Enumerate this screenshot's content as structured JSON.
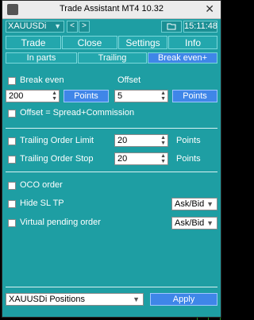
{
  "window": {
    "title": "Trade Assistant MT4 10.32"
  },
  "toolbar": {
    "symbol": "XAUUSDi",
    "prev": "<",
    "next": ">",
    "time": "15:11:48"
  },
  "tabs": [
    "Trade",
    "Close",
    "Settings",
    "Info"
  ],
  "subtabs": [
    "In parts",
    "Trailing",
    "Break even+"
  ],
  "break_even": {
    "label": "Break even",
    "offset_header": "Offset",
    "points_value": "200",
    "offset_value": "5",
    "points_button": "Points",
    "offset_points_button": "Points",
    "spread_label": "Offset = Spread+Commission"
  },
  "trailing": {
    "limit_label": "Trailing Order Limit",
    "limit_value": "20",
    "limit_unit": "Points",
    "stop_label": "Trailing Order Stop",
    "stop_value": "20",
    "stop_unit": "Points"
  },
  "options": {
    "oco_label": "OCO order",
    "hide_sltp_label": "Hide SL TP",
    "hide_sltp_select": "Ask/Bid",
    "virtual_label": "Virtual pending order",
    "virtual_select": "Ask/Bid"
  },
  "footer": {
    "positions_select": "XAUUSDi Positions",
    "apply": "Apply"
  },
  "colors": {
    "panel": "#1e9ea3",
    "accent": "#3f86e8"
  }
}
